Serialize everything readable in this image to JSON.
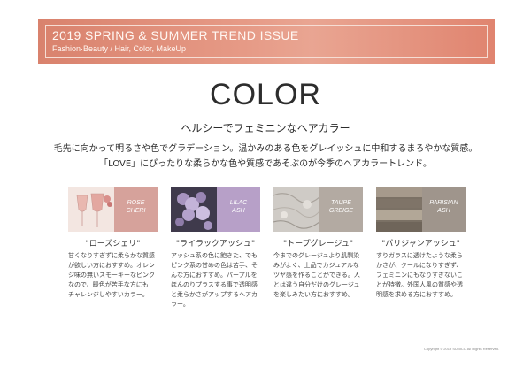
{
  "banner": {
    "title": "2019 SPRING & SUMMER TREND ISSUE",
    "subtitle": "Fashion·Beauty / Hair, Color, MakeUp"
  },
  "heading": "COLOR",
  "subheading": "ヘルシーでフェミニンなヘアカラー",
  "description": [
    "毛先に向かって明るさや色でグラデーション。温かみのある色をグレイッシュに中和するまろやかな質感。",
    "「LOVE」にぴったりな柔らかな色や質感であそぶのが今季のヘアカラートレンド。"
  ],
  "colors": {
    "rose": "#d6a29b",
    "lilac": "#b7a0c8",
    "taupe": "#b3aaa2",
    "parisian": "#9f958c",
    "banner": "#e08a75"
  },
  "cards": [
    {
      "chip_label": "ROSE\nCHERI",
      "name": "\"ローズシェリ\"",
      "lines": [
        "甘くなりすぎずに柔らかな質感",
        "が欲しい方におすすめ。オレン",
        "ジ味の無いスモーキーなピンク",
        "なので、暖色が苦手な方にも",
        "チャレンジしやすいカラー。"
      ]
    },
    {
      "chip_label": "LILAC\nASH",
      "name": "\"ライラックアッシュ\"",
      "lines": [
        "アッシュ系の色に飽きた、でも",
        "ピンク系の甘めの色は苦手、そ",
        "んな方におすすめ。パープルを",
        "ほんのりプラスする事で透明感",
        "と柔らかさがアップするヘアカ",
        "ラー。"
      ]
    },
    {
      "chip_label": "TAUPE\nGREIGE",
      "name": "\"トープグレージュ\"",
      "lines": [
        "今までのグレージュより肌馴染",
        "みがよく、上品でカジュアルな",
        "ツヤ感を作ることができる。人",
        "とは違う自分だけのグレージュ",
        "を楽しみたい方におすすめ。"
      ]
    },
    {
      "chip_label": "PARISIAN\nASH",
      "name": "\"パリジャンアッシュ\"",
      "lines": [
        "すりガラスに透けたような柔ら",
        "かさが、クールになりすぎず、",
        "フェミニンにもなりすぎないこ",
        "とが特徴。外国人風の質感や透",
        "明感を求める方におすすめ。"
      ]
    }
  ],
  "footer": "Copyright © 2019 SUNICO All Rights Reserved."
}
